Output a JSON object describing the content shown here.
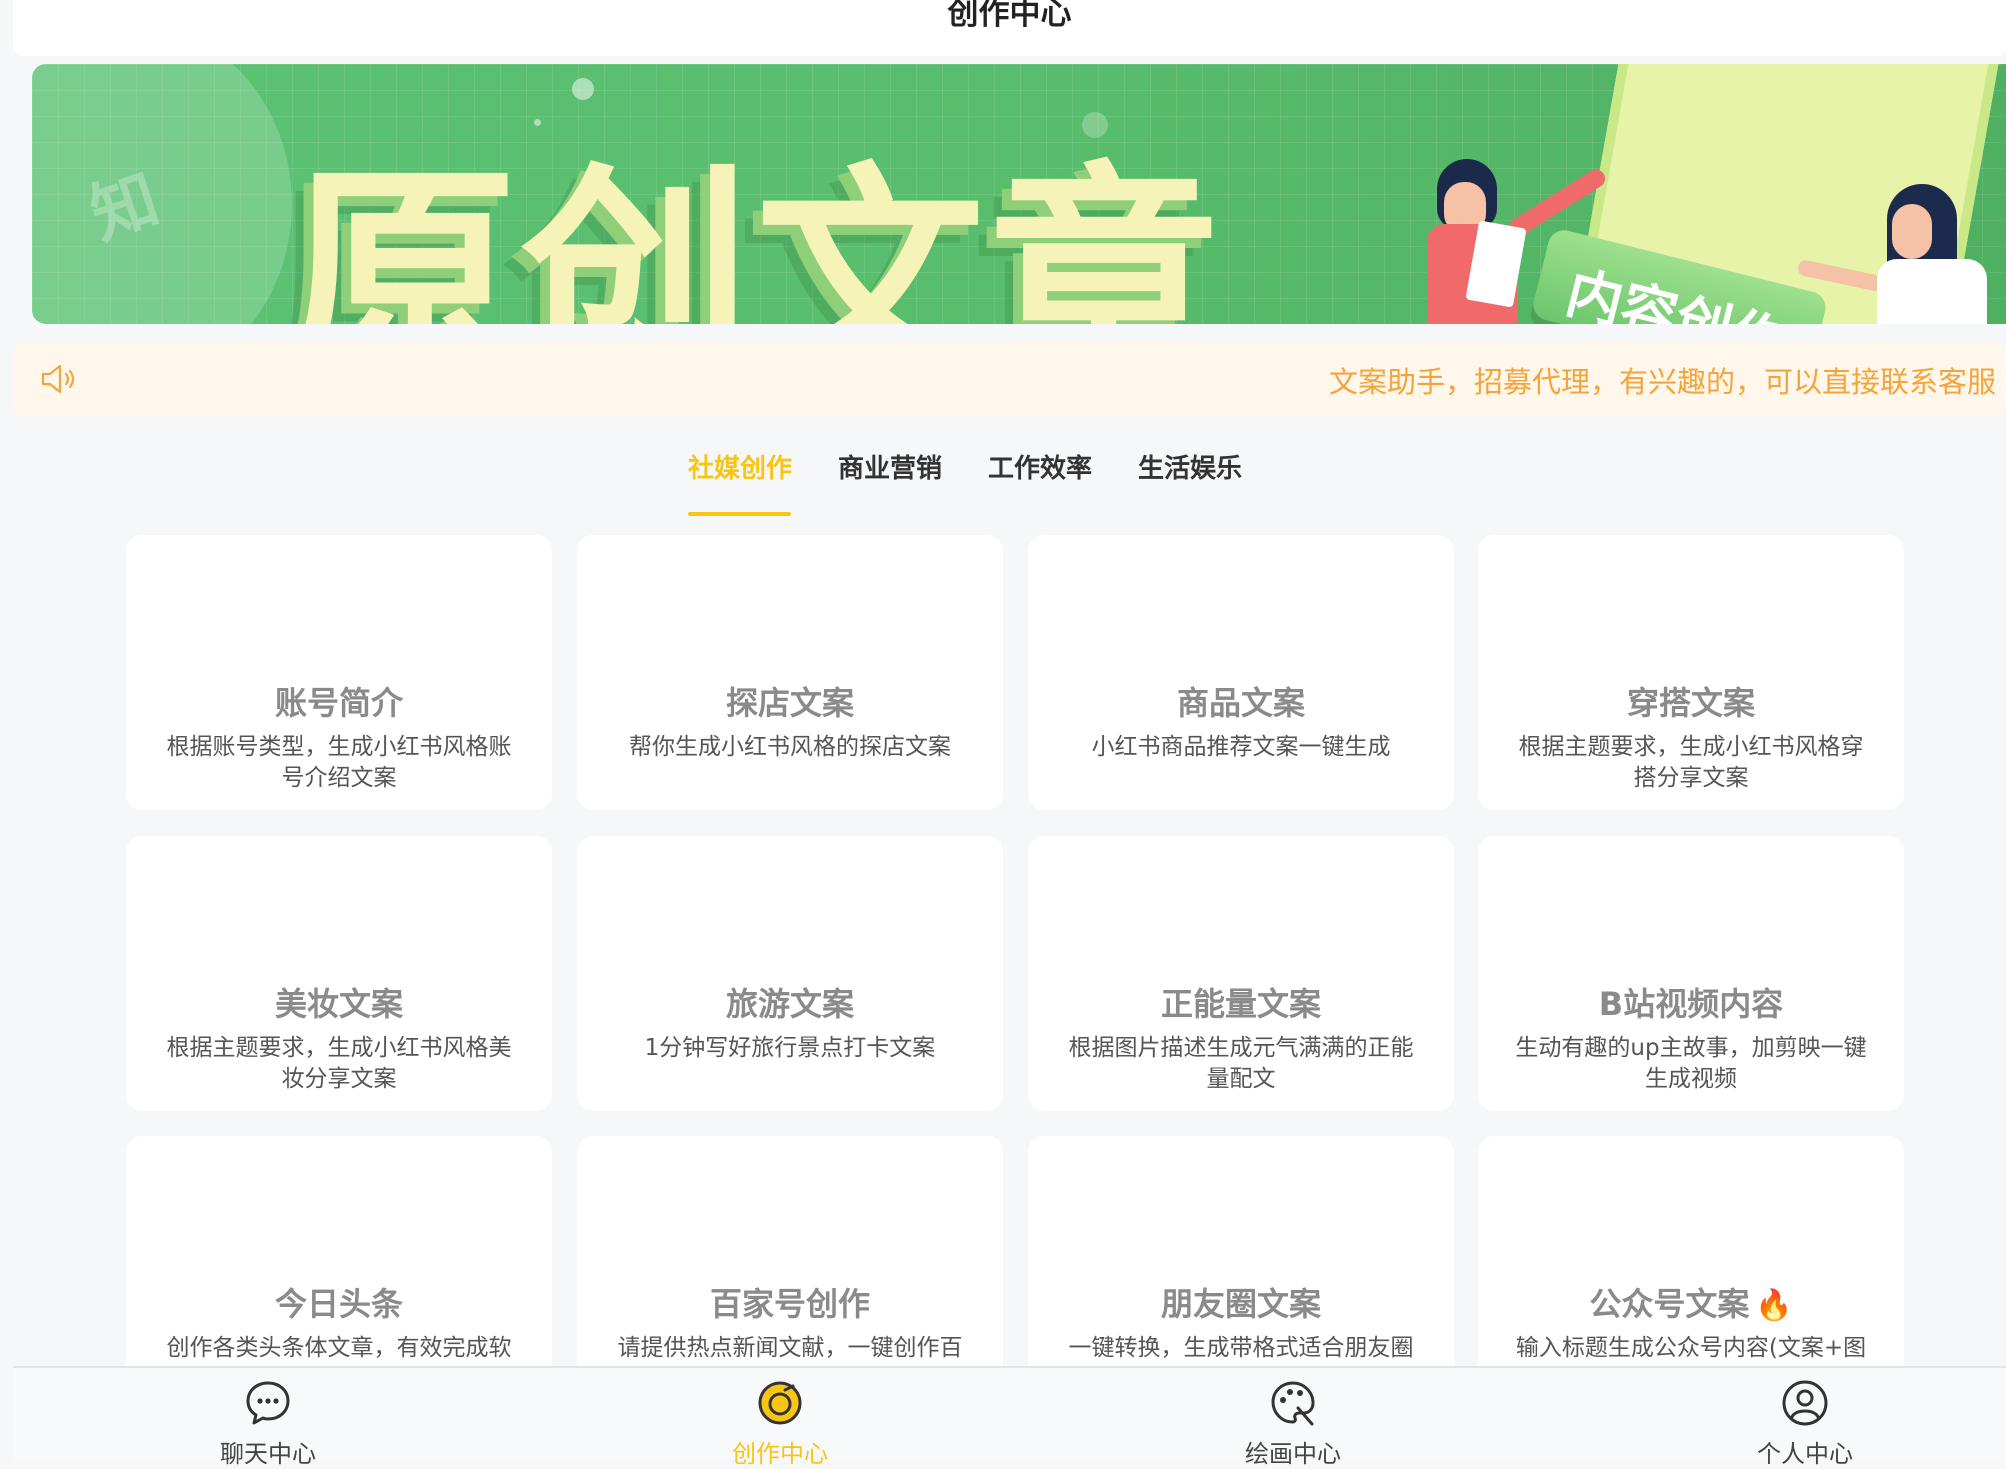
{
  "header": {
    "title": "创作中心"
  },
  "banner": {
    "title": "原创文章",
    "badge": "内容创作",
    "watermark": "知"
  },
  "notice": {
    "text": "文案助手，招募代理，有兴趣的，可以直接联系客服",
    "icon": "speaker-icon"
  },
  "tabs": [
    {
      "label": "社媒创作",
      "active": true
    },
    {
      "label": "商业营销",
      "active": false
    },
    {
      "label": "工作效率",
      "active": false
    },
    {
      "label": "生活娱乐",
      "active": false
    }
  ],
  "cards": [
    {
      "title": "账号简介",
      "desc": "根据账号类型，生成小红书风格账号介绍文案"
    },
    {
      "title": "探店文案",
      "desc": "帮你生成小红书风格的探店文案"
    },
    {
      "title": "商品文案",
      "desc": "小红书商品推荐文案一键生成"
    },
    {
      "title": "穿搭文案",
      "desc": "根据主题要求，生成小红书风格穿搭分享文案"
    },
    {
      "title": "美妆文案",
      "desc": "根据主题要求，生成小红书风格美妆分享文案"
    },
    {
      "title": "旅游文案",
      "desc": "1分钟写好旅行景点打卡文案"
    },
    {
      "title": "正能量文案",
      "desc": "根据图片描述生成元气满满的正能量配文"
    },
    {
      "title": "B站视频内容",
      "desc": "生动有趣的up主故事，加剪映一键生成视频"
    },
    {
      "title": "今日头条",
      "desc": "创作各类头条体文章，有效完成软"
    },
    {
      "title": "百家号创作",
      "desc": "请提供热点新闻文献，一键创作百"
    },
    {
      "title": "朋友圈文案",
      "desc": "一键转换，生成带格式适合朋友圈"
    },
    {
      "title": "公众号文案",
      "desc": "输入标题生成公众号内容(文案+图",
      "badge_icon": "fire-icon"
    }
  ],
  "bottom_nav": [
    {
      "label": "聊天中心",
      "icon": "chat-bubble-icon",
      "active": false
    },
    {
      "label": "创作中心",
      "icon": "create-icon",
      "active": true
    },
    {
      "label": "绘画中心",
      "icon": "palette-icon",
      "active": false
    },
    {
      "label": "个人中心",
      "icon": "user-icon",
      "active": false
    }
  ],
  "colors": {
    "accent": "#f8c516",
    "notice_text": "#f3a53a",
    "notice_bg": "#fff6ec",
    "banner_green": "#58bd6c"
  }
}
